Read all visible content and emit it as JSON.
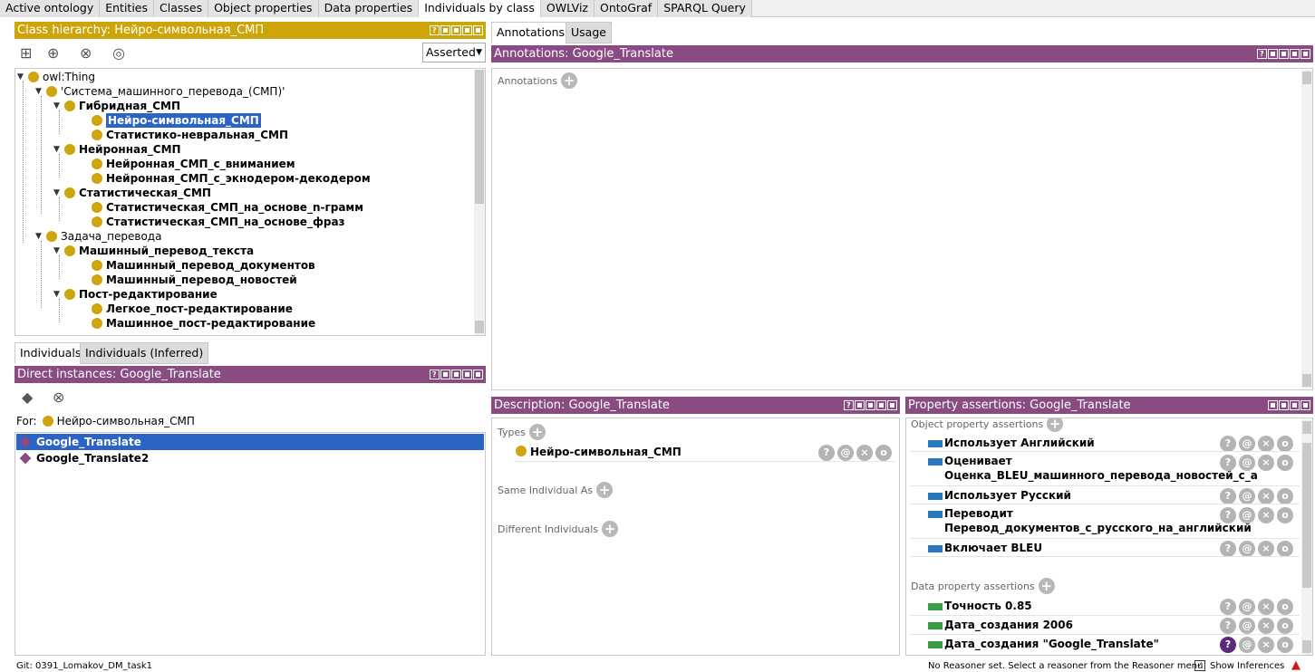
{
  "top_tabs": [
    "Active ontology",
    "Entities",
    "Classes",
    "Object properties",
    "Data properties",
    "Individuals by class",
    "OWLViz",
    "OntoGraf",
    "SPARQL Query"
  ],
  "class_panel": {
    "title": "Class hierarchy: Нейро-символьная_СМП",
    "mode": "Asserted",
    "tree": [
      "owl:Thing",
      "'Система_машинного_перевода_(СМП)'",
      "Гибридная_СМП",
      "Нейро-символьная_СМП",
      "Статистико-невральная_СМП",
      "Нейронная_СМП",
      "Нейронная_СМП_с_вниманием",
      "Нейронная_СМП_с_экнодером-декодером",
      "Статистическая_СМП",
      "Статистическая_СМП_на_основе_n-грамм",
      "Статистическая_СМП_на_основе_фраз",
      "Задача_перевода",
      "Машинный_перевод_текста",
      "Машинный_перевод_документов",
      "Машинный_перевод_новостей",
      "Пост-редактирование",
      "Легкое_пост-редактирование",
      "Машинное_пост-редактирование"
    ]
  },
  "ind_tabs": [
    "Individuals",
    "Individuals (Inferred)"
  ],
  "instances": {
    "title": "Direct instances: Google_Translate",
    "for_label": "For:",
    "for_class": "Нейро-символьная_СМП",
    "items": [
      "Google_Translate",
      "Google_Translate2"
    ]
  },
  "right_tabs": [
    "Annotations",
    "Usage"
  ],
  "annotations": {
    "title": "Annotations: Google_Translate",
    "label": "Annotations"
  },
  "description": {
    "title": "Description: Google_Translate",
    "types_label": "Types",
    "type": "Нейро-символьная_СМП",
    "same_label": "Same Individual As",
    "diff_label": "Different Individuals"
  },
  "props": {
    "title": "Property assertions: Google_Translate",
    "obj_label": "Object property assertions",
    "data_label": "Data property assertions",
    "obj": [
      [
        "Использует",
        "Английский"
      ],
      [
        "Оценивает",
        "Оценка_BLEU_машинного_перевода_новостей_с_а"
      ],
      [
        "Использует",
        "Русский"
      ],
      [
        "Переводит",
        "Перевод_документов_с_русского_на_английский"
      ],
      [
        "Включает",
        "BLEU"
      ]
    ],
    "data": [
      [
        "Точность",
        "0.85"
      ],
      [
        "Дата_создания",
        "2006"
      ],
      [
        "Дата_создания",
        "\"Google_Translate\""
      ]
    ]
  },
  "status": {
    "left": "Git: 0391_Lomakov_DM_task1",
    "right": "No Reasoner set. Select a reasoner from the Reasoner menu",
    "show_inf": "Show Inferences"
  },
  "colors": {
    "gold": "#cda50a",
    "purple": "#8a4b83",
    "select": "#2a64c5"
  }
}
